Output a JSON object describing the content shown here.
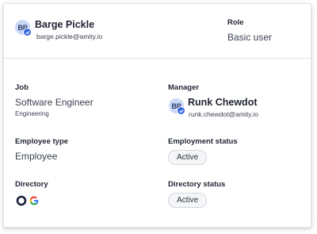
{
  "user": {
    "initials": "BP",
    "name": "Barge Pickle",
    "email": "barge.pickle@amity.io"
  },
  "role": {
    "label": "Role",
    "value": "Basic user"
  },
  "job": {
    "label": "Job",
    "title": "Software Engineer",
    "department": "Engineering"
  },
  "manager": {
    "label": "Manager",
    "initials": "BP",
    "name": "Runk Chewdot",
    "email": "runk.chewdot@amity.io"
  },
  "employee_type": {
    "label": "Employee type",
    "value": "Employee"
  },
  "employment_status": {
    "label": "Employment status",
    "value": "Active"
  },
  "directory": {
    "label": "Directory",
    "icons": [
      "okta-icon",
      "google-icon"
    ]
  },
  "directory_status": {
    "label": "Directory status",
    "value": "Active"
  },
  "colors": {
    "avatar_bg": "#c9d9f6",
    "badge": "#3a6ae0",
    "pill_bg": "#f5f6f8",
    "divider": "#e3e5ea"
  }
}
